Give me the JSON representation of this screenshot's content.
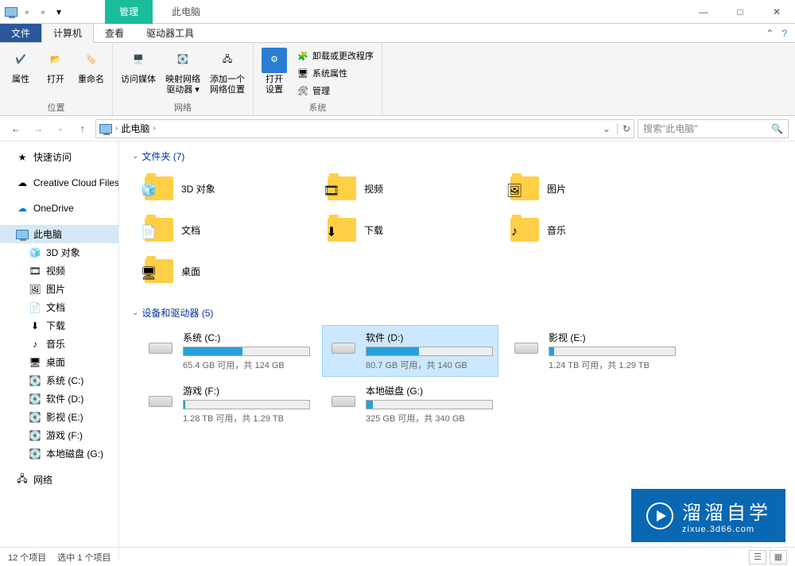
{
  "titlebar": {
    "contextual": "管理",
    "title": "此电脑"
  },
  "wincontrols": {
    "min": "—",
    "max": "□",
    "close": "✕"
  },
  "tabs": {
    "file": "文件",
    "computer": "计算机",
    "view": "查看",
    "drivetools": "驱动器工具"
  },
  "ribbon": {
    "g1": {
      "label": "位置",
      "properties": "属性",
      "open": "打开",
      "rename": "重命名"
    },
    "g2": {
      "label": "网络",
      "media": "访问媒体",
      "mapdrive": "映射网络\n驱动器 ▾",
      "addloc": "添加一个\n网络位置"
    },
    "g3": {
      "label": "系统",
      "opensettings": "打开\n设置",
      "uninstall": "卸载或更改程序",
      "sysprops": "系统属性",
      "manage": "管理"
    }
  },
  "nav": {
    "back": "←",
    "fwd": "→",
    "up": "↑"
  },
  "address": {
    "root": "此电脑",
    "chev": "›",
    "dropdown": "⌄",
    "refresh": "↻"
  },
  "search": {
    "placeholder": "搜索\"此电脑\"",
    "icon": "🔍"
  },
  "sidebar": {
    "quick": "快速访问",
    "ccf": "Creative Cloud Files",
    "onedrive": "OneDrive",
    "thispc": "此电脑",
    "obj3d": "3D 对象",
    "videos": "视频",
    "pictures": "图片",
    "documents": "文档",
    "downloads": "下载",
    "music": "音乐",
    "desktop": "桌面",
    "dc": "系统 (C:)",
    "dd": "软件 (D:)",
    "de": "影视 (E:)",
    "df": "游戏 (F:)",
    "dg": "本地磁盘 (G:)",
    "network": "网络"
  },
  "sections": {
    "folders": "文件夹 (7)",
    "drives": "设备和驱动器 (5)"
  },
  "folders": [
    {
      "name": "3D 对象"
    },
    {
      "name": "视频"
    },
    {
      "name": "图片"
    },
    {
      "name": "文档"
    },
    {
      "name": "下载"
    },
    {
      "name": "音乐"
    },
    {
      "name": "桌面"
    }
  ],
  "drives": [
    {
      "name": "系统 (C:)",
      "free": "65.4 GB 可用，共 124 GB",
      "pct": 47
    },
    {
      "name": "软件 (D:)",
      "free": "80.7 GB 可用，共 140 GB",
      "pct": 42,
      "selected": true
    },
    {
      "name": "影视 (E:)",
      "free": "1.24 TB 可用，共 1.29 TB",
      "pct": 4
    },
    {
      "name": "游戏 (F:)",
      "free": "1.28 TB 可用，共 1.29 TB",
      "pct": 1
    },
    {
      "name": "本地磁盘 (G:)",
      "free": "325 GB 可用，共 340 GB",
      "pct": 5
    }
  ],
  "status": {
    "count": "12 个项目",
    "selected": "选中 1 个项目"
  },
  "watermark": {
    "text": "溜溜自学",
    "sub": "zixue.3d66.com"
  }
}
